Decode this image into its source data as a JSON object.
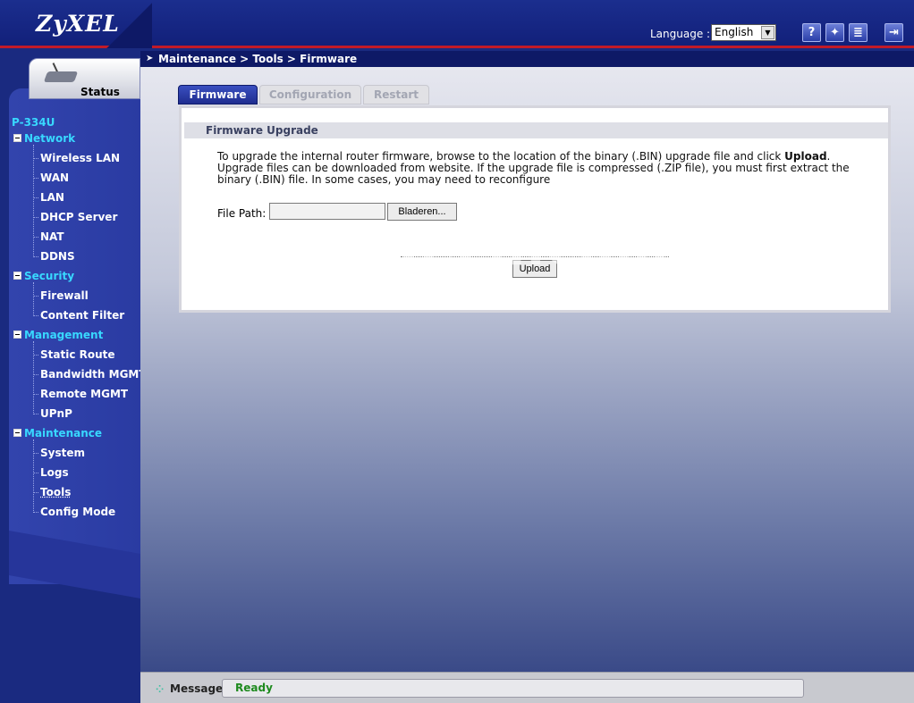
{
  "header": {
    "logo": "ZyXEL",
    "language_label": "Language :",
    "language_value": "English",
    "buttons": {
      "help": "?",
      "wizard": "✦",
      "notes": "≣",
      "logout": "⇥"
    }
  },
  "sidebar": {
    "status_label": "Status",
    "device": "P-334U",
    "sections": [
      {
        "label": "Network",
        "items": [
          "Wireless LAN",
          "WAN",
          "LAN",
          "DHCP Server",
          "NAT",
          "DDNS"
        ]
      },
      {
        "label": "Security",
        "items": [
          "Firewall",
          "Content Filter"
        ]
      },
      {
        "label": "Management",
        "items": [
          "Static Route",
          "Bandwidth MGMT",
          "Remote MGMT",
          "UPnP"
        ]
      },
      {
        "label": "Maintenance",
        "items": [
          "System",
          "Logs",
          "Tools",
          "Config Mode"
        ]
      }
    ]
  },
  "breadcrumb": "Maintenance > Tools > Firmware",
  "tabs": [
    "Firmware",
    "Configuration",
    "Restart"
  ],
  "panel": {
    "title": "Firmware Upgrade",
    "desc_part1": "To upgrade the internal router firmware, browse to the location of the binary (.BIN) upgrade file and click ",
    "desc_bold": "Upload",
    "desc_part2": ". Upgrade files can be downloaded from website. If the upgrade file is compressed (.ZIP file), you must first extract the binary (.BIN) file. In some cases, you may need to reconfigure",
    "file_label": "File Path:",
    "file_value": "",
    "browse_label": "Bladeren...",
    "upload_label": "Upload"
  },
  "watermark": "PcWinTech.com",
  "status_bar": {
    "label": "Message",
    "text": "Ready"
  },
  "colors": {
    "accent": "#1a2a80",
    "header_stripe": "#c21a28",
    "menu_section": "#38d8ff",
    "ready": "#1e8a1e"
  }
}
